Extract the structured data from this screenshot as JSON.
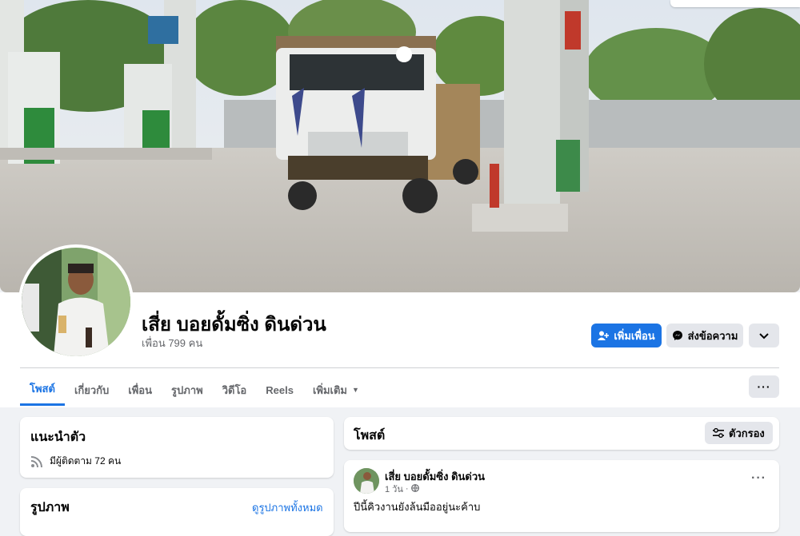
{
  "profile": {
    "name": "เสี่ย บอยดั้มซิ่ง ดินด่วน",
    "friends": "เพื่อน 799 คน"
  },
  "actions": {
    "add_friend": "เพิ่มเพื่อน",
    "message": "ส่งข้อความ"
  },
  "tabs": [
    {
      "label": "โพสต์"
    },
    {
      "label": "เกี่ยวกับ"
    },
    {
      "label": "เพื่อน"
    },
    {
      "label": "รูปภาพ"
    },
    {
      "label": "วิดีโอ"
    },
    {
      "label": "Reels"
    },
    {
      "label": "เพิ่มเติม"
    }
  ],
  "intro": {
    "title": "แนะนำตัว",
    "followers": "มีผู้ติดตาม 72 คน"
  },
  "photos": {
    "title": "รูปภาพ",
    "see_all": "ดูรูปภาพทั้งหมด"
  },
  "posts": {
    "title": "โพสต์",
    "filter": "ตัวกรอง",
    "items": [
      {
        "author": "เสี่ย บอยดั้มซิ่ง ดินด่วน",
        "time": "1 วัน",
        "text": "ปีนี้คิวงานยังล้นมืออยู่นะค้าบ"
      }
    ]
  },
  "colors": {
    "accent": "#1b74e4",
    "background": "#f0f2f5"
  }
}
